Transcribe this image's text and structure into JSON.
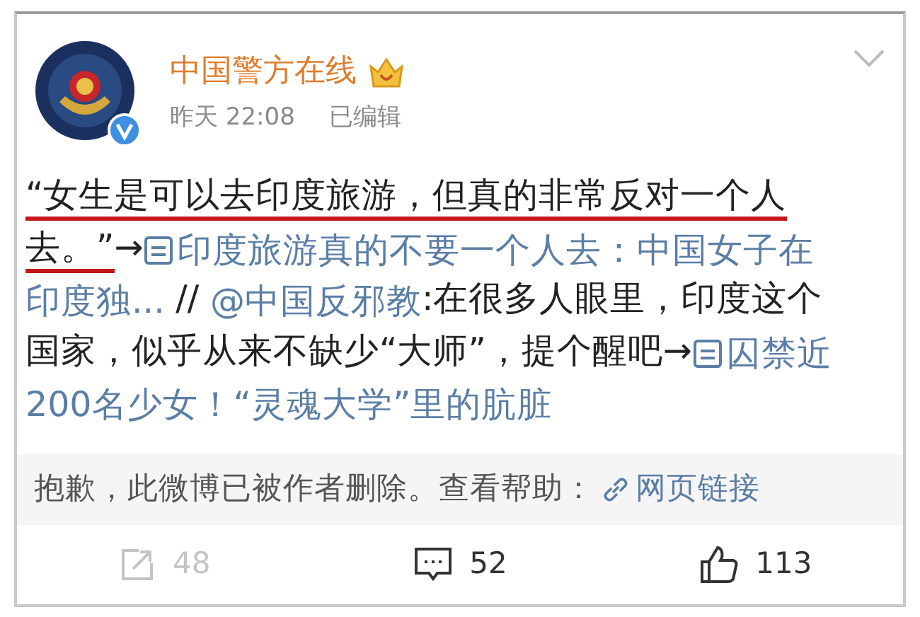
{
  "author": {
    "name": "中国警方在线",
    "time": "昨天 22:08",
    "edited": "已编辑"
  },
  "content_lines": [
    [
      {
        "kind": "text",
        "text": "“女生是可以去印度旅游，但真的非常反对一个人",
        "underlined": true
      }
    ],
    [
      {
        "kind": "text",
        "text": "去。”",
        "underlined": true
      },
      {
        "kind": "text",
        "text": "→",
        "underlined": false
      },
      {
        "kind": "link",
        "icon": true,
        "text": "印度旅游真的不要一个人去：中国女子在"
      }
    ],
    [
      {
        "kind": "link",
        "icon": false,
        "text": "印度独..."
      },
      {
        "kind": "text",
        "text": " // ",
        "underlined": false
      },
      {
        "kind": "link",
        "icon": false,
        "text": "@中国反邪教"
      },
      {
        "kind": "text",
        "text": ":在很多人眼里，印度这个",
        "underlined": false
      }
    ],
    [
      {
        "kind": "text",
        "text": "国家，似乎从来不缺少“大师”，提个醒吧→",
        "underlined": false
      },
      {
        "kind": "link",
        "icon": true,
        "text": "囚禁近"
      }
    ],
    [
      {
        "kind": "link",
        "icon": false,
        "text": "200名少女！“灵魂大学”里的肮脏"
      }
    ]
  ],
  "deleted_notice": {
    "text": "抱歉，此微博已被作者删除。查看帮助：",
    "link": "网页链接"
  },
  "actions": [
    {
      "kind": "repost",
      "count": "48",
      "disabled": true
    },
    {
      "kind": "comment",
      "count": "52",
      "disabled": false
    },
    {
      "kind": "like",
      "count": "113",
      "disabled": false
    }
  ]
}
